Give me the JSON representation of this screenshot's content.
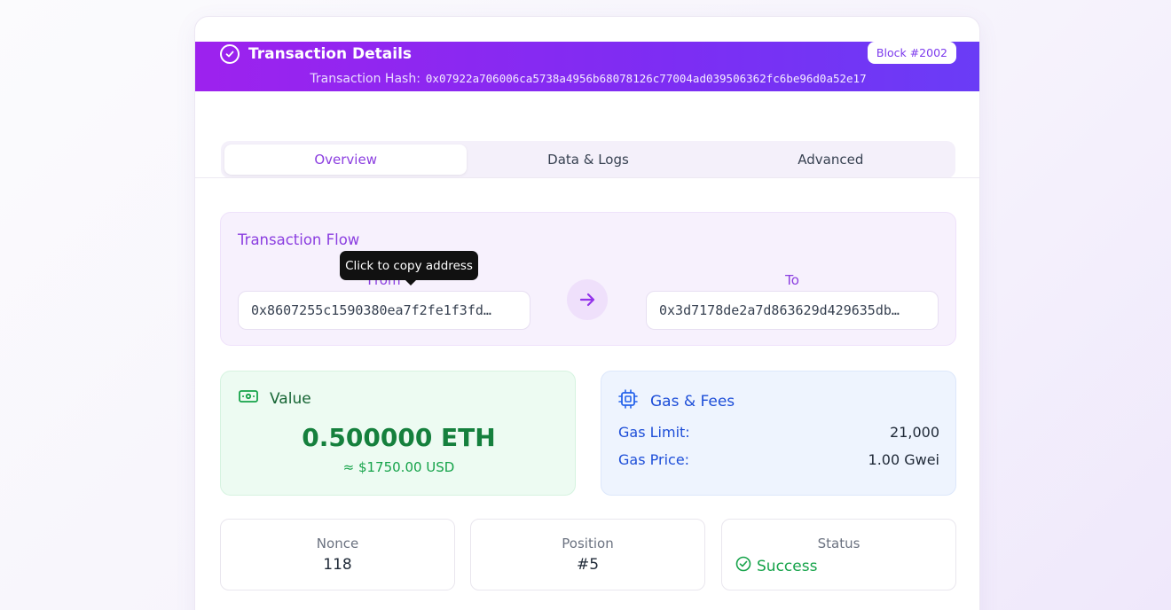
{
  "header": {
    "title": "Transaction Details",
    "block_badge": "Block #2002",
    "hash_label": "Transaction Hash:",
    "hash_value": "0x07922a706006ca5738a4956b68078126c77004ad039506362fc6be96d0a52e17",
    "icon": "check-circle-icon"
  },
  "tabs": [
    {
      "label": "Overview",
      "active": true
    },
    {
      "label": "Data & Logs",
      "active": false
    },
    {
      "label": "Advanced",
      "active": false
    }
  ],
  "flow": {
    "title": "Transaction Flow",
    "from_label": "From",
    "to_label": "To",
    "from_address": "0x8607255c1590380ea7f2fe1f3fd…",
    "to_address": "0x3d7178de2a7d863629d429635db…",
    "tooltip": "Click to copy address",
    "arrow_icon": "arrow-right-icon"
  },
  "value": {
    "title": "Value",
    "amount": "0.500000 ETH",
    "usd": "≈ $1750.00 USD",
    "icon": "banknote-icon"
  },
  "gas": {
    "title": "Gas & Fees",
    "icon": "cpu-icon",
    "rows": [
      {
        "label": "Gas Limit:",
        "value": "21,000"
      },
      {
        "label": "Gas Price:",
        "value": "1.00 Gwei"
      }
    ]
  },
  "stats": {
    "nonce_label": "Nonce",
    "nonce_value": "118",
    "position_label": "Position",
    "position_value": "#5",
    "status_label": "Status",
    "status_value": "Success"
  },
  "colors": {
    "accent": "#8b3ee0",
    "header_gradient_start": "#9d22ee",
    "header_gradient_end": "#6a3cf6",
    "success": "#16a34a",
    "info": "#1d4ed8"
  }
}
